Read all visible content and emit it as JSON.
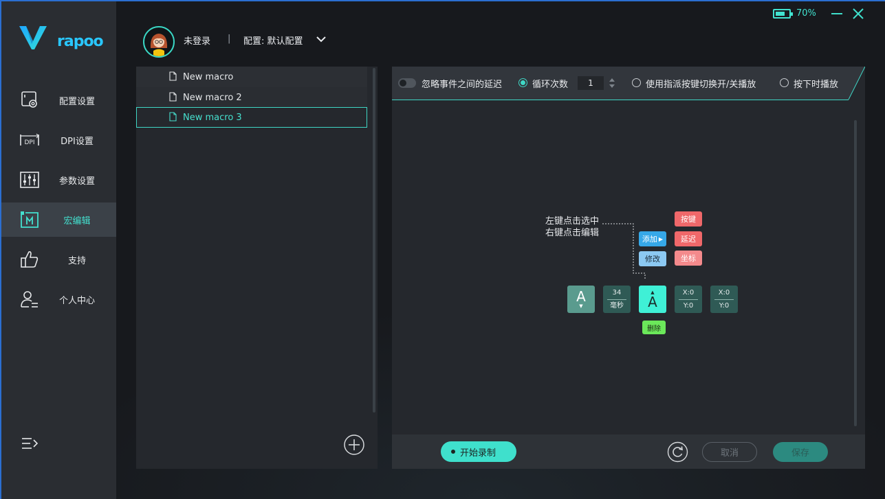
{
  "app": {
    "logo_text": "rapoo",
    "accent": "#3fd8c6"
  },
  "status": {
    "battery_text": "70%",
    "battery_level": 0.7
  },
  "user": {
    "name": "未登录",
    "separator": "|",
    "config_label": "配置: 默认配置"
  },
  "sidebar": {
    "items": [
      {
        "label": "配置设置",
        "icon": "config-icon"
      },
      {
        "label": "DPI设置",
        "icon": "dpi-icon",
        "icon_text": "DPI"
      },
      {
        "label": "参数设置",
        "icon": "sliders-icon"
      },
      {
        "label": "宏编辑",
        "icon": "macro-icon",
        "active": true
      },
      {
        "label": "支持",
        "icon": "thumbs-up-icon"
      },
      {
        "label": "个人中心",
        "icon": "user-icon"
      }
    ]
  },
  "macros": {
    "items": [
      {
        "name": "New macro"
      },
      {
        "name": "New macro 2"
      },
      {
        "name": "New macro 3",
        "selected": true
      }
    ]
  },
  "options": {
    "ignore_delay_label": "忽略事件之间的延迟",
    "loop_count_label": "循环次数",
    "loop_count_value": "1",
    "toggle_play_label": "使用指派按键切换开/关播放",
    "hold_play_label": "按下时播放"
  },
  "help": {
    "left_click_hint": "左键点击选中",
    "right_click_hint": "右键点击编辑",
    "add_label": "添加",
    "modify_label": "修改",
    "key_label": "按键",
    "delay_label": "延迟",
    "coord_label": "坐标",
    "delete_label": "删除",
    "events": {
      "key1": "A",
      "delay_value": "34",
      "delay_unit": "毫秒",
      "key2": "A",
      "coord1_x": "X:0",
      "coord1_y": "Y:0",
      "coord2_x": "X:0",
      "coord2_y": "Y:0"
    }
  },
  "footer": {
    "record_label": "开始录制",
    "cancel_label": "取消",
    "save_label": "保存"
  }
}
